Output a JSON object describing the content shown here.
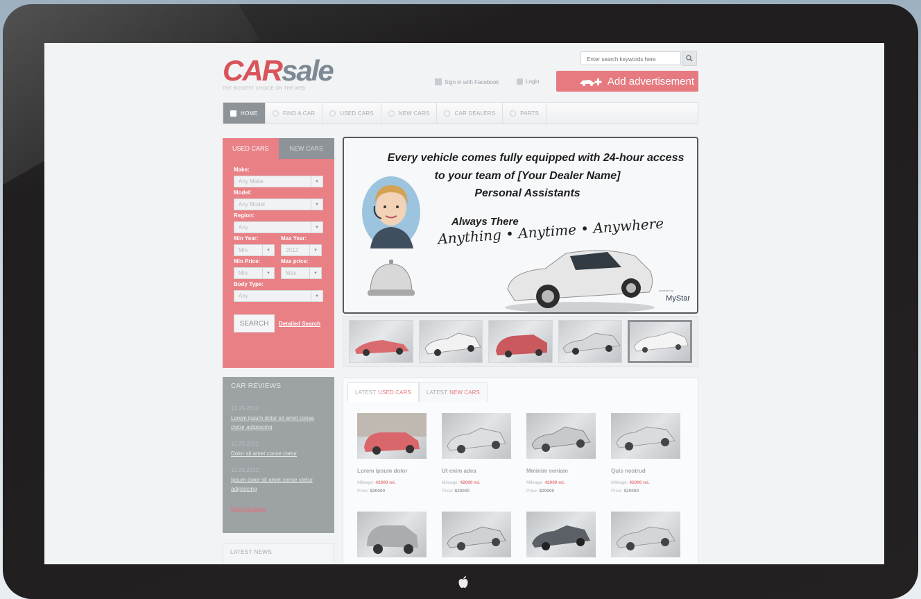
{
  "header": {
    "logo_car": "CAR",
    "logo_sale": "sale",
    "tagline": "THE BIGGEST CHOICE ON THE WEB",
    "search_placeholder": "Enter search keywords here",
    "facebook_label": "Sign in with Facebook",
    "login_label": "Login",
    "add_ad_label": "Add advertisement"
  },
  "nav": {
    "items": [
      {
        "label": "HOME"
      },
      {
        "label": "FIND A CAR"
      },
      {
        "label": "USED CARS"
      },
      {
        "label": "NEW CARS"
      },
      {
        "label": "CAR DEALERS"
      },
      {
        "label": "PARTS"
      }
    ]
  },
  "search_panel": {
    "tabs": [
      "USED CARS",
      "NEW CARS"
    ],
    "make_label": "Make:",
    "make_value": "Any Make",
    "model_label": "Model:",
    "model_value": "Any Model",
    "region_label": "Region:",
    "region_value": "Any",
    "min_year_label": "Min Year:",
    "min_year_value": "Min",
    "max_year_label": "Max Year:",
    "max_year_value": "2012",
    "min_price_label": "Min Price:",
    "min_price_value": "Min",
    "max_price_label": "Max price:",
    "max_price_value": "Max",
    "body_label": "Body Type:",
    "body_value": "Any",
    "search_button": "SEARCH",
    "detailed_link": "Detailed Search"
  },
  "reviews": {
    "title": "CAR REVIEWS",
    "items": [
      {
        "date": "12.25.2012",
        "text": "Lorem ipsum dolor sit amet conse ctetur adipisicing"
      },
      {
        "date": "12.25.2012",
        "text": "Dolor sit amet conse ctetur"
      },
      {
        "date": "12.25.2012",
        "text": "Ipsum dolor sit amet conse ctetur adipisicing"
      }
    ],
    "more": "More Reviews"
  },
  "news": {
    "title": "LATEST NEWS"
  },
  "banner": {
    "line1": "Every vehicle comes fully equipped with 24-hour access",
    "line2": "to your team of [Your Dealer Name]",
    "line3": "Personal Assistants",
    "always": "Always There",
    "script": "Anything • Anytime • Anywhere",
    "brand": "MyStar",
    "brand_sub": "powered by"
  },
  "latest": {
    "tab1_prefix": "LATEST",
    "tab1_accent": "USED CARS",
    "tab2_prefix": "LATEST",
    "tab2_accent": "NEW CARS",
    "cars": [
      {
        "name": "Lorem ipsum dolor",
        "mileage_label": "Mileage:",
        "mileage": "42000 mi.",
        "price_label": "Price:",
        "price": "$20000"
      },
      {
        "name": "Ut enim adea",
        "mileage_label": "Mileage:",
        "mileage": "42000 mi.",
        "price_label": "Price:",
        "price": "$20000"
      },
      {
        "name": "Mminim veniam",
        "mileage_label": "Mileage:",
        "mileage": "42000 mi.",
        "price_label": "Price:",
        "price": "$20000"
      },
      {
        "name": "Quis nostrud",
        "mileage_label": "Mileage:",
        "mileage": "42000 mi.",
        "price_label": "Price:",
        "price": "$20000"
      }
    ]
  },
  "colors": {
    "accent": "#e67a80",
    "logo_red": "#d9535b",
    "device_bezel": "#232121",
    "nav_active": "#8d9397"
  }
}
